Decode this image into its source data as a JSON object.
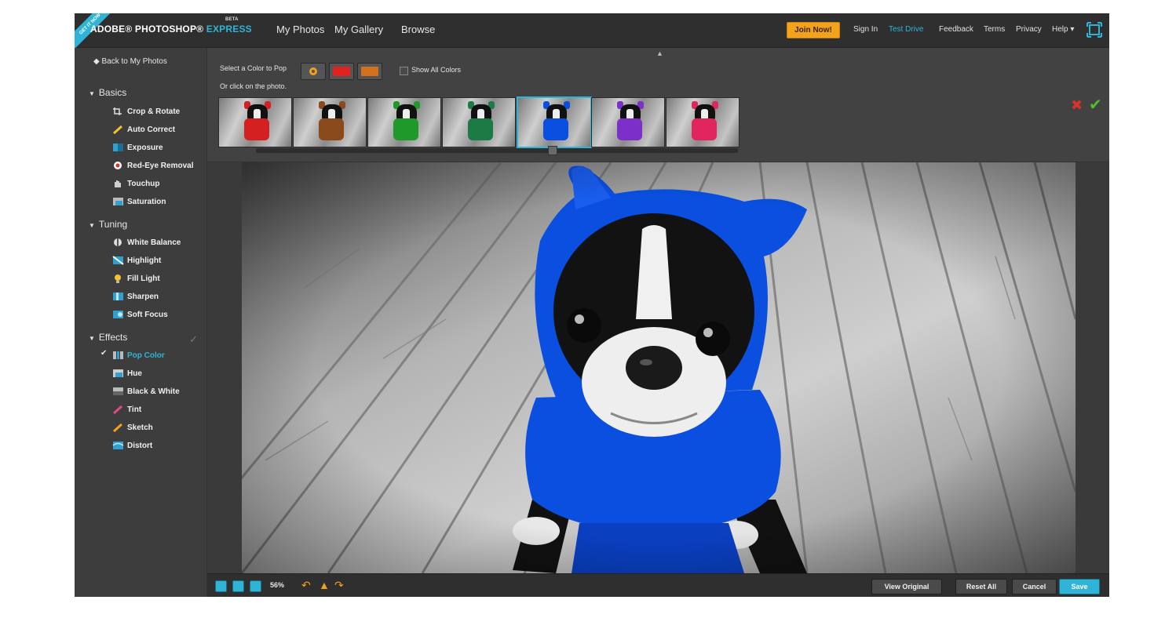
{
  "app": {
    "ribbon_text": "GET IT NOW",
    "logo_prefix": "ADOBE® PHOTOSHOP®",
    "logo_express": "EXPRESS",
    "logo_beta": "BETA"
  },
  "nav": {
    "my_photos": "My Photos",
    "my_gallery": "My Gallery",
    "browse": "Browse"
  },
  "top_links": {
    "join": "Join Now!",
    "sign_in": "Sign In",
    "test_drive": "Test Drive",
    "feedback": "Feedback",
    "terms": "Terms",
    "privacy": "Privacy",
    "help": "Help ▾"
  },
  "sidebar": {
    "back": "◆ Back to My Photos",
    "basics": {
      "label": "Basics",
      "items": [
        "Crop & Rotate",
        "Auto Correct",
        "Exposure",
        "Red-Eye Removal",
        "Touchup",
        "Saturation"
      ]
    },
    "tuning": {
      "label": "Tuning",
      "items": [
        "White Balance",
        "Highlight",
        "Fill Light",
        "Sharpen",
        "Soft Focus"
      ]
    },
    "effects": {
      "label": "Effects",
      "items": [
        "Pop Color",
        "Hue",
        "Black & White",
        "Tint",
        "Sketch",
        "Distort"
      ]
    }
  },
  "options": {
    "select_label": "Select a Color to Pop",
    "or_label": "Or click on the photo.",
    "show_all": "Show All Colors",
    "swatch_colors": [
      "#f0a11e",
      "#e0231f",
      "#d5701d"
    ],
    "thumb_colors": [
      "#d42020",
      "#8a4a1c",
      "#1f9a2a",
      "#1c7a44",
      "#0a4fe0",
      "#7d2fc9",
      "#e0265c"
    ],
    "selected_thumb": 4
  },
  "bottom": {
    "zoom": "56%",
    "view_original": "View Original",
    "reset_all": "Reset All",
    "cancel": "Cancel",
    "save": "Save"
  },
  "colors": {
    "accent": "#2fb4d8",
    "join": "#f2a21b",
    "pop": "#0a4fe0"
  }
}
